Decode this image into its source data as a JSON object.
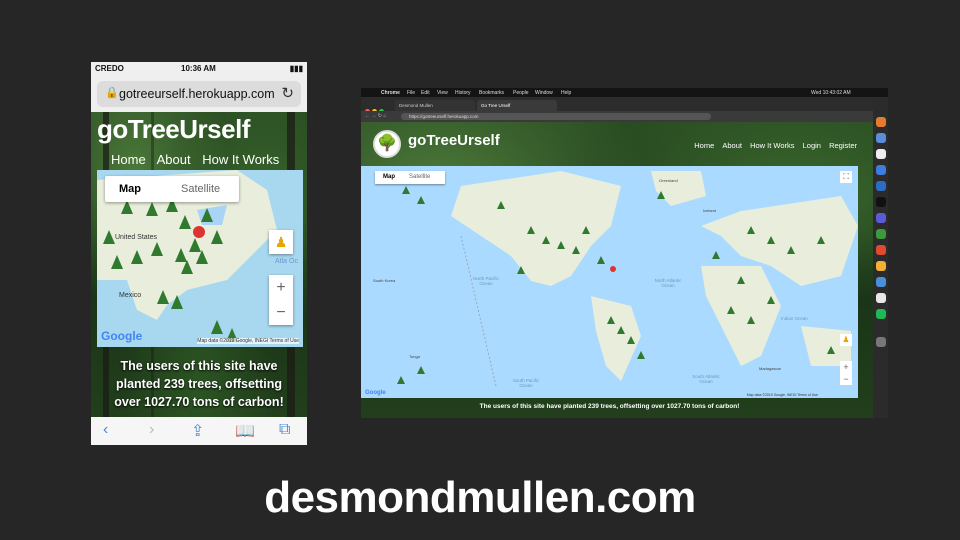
{
  "phone": {
    "status": {
      "carrier": "CREDO",
      "time": "10:36 AM"
    },
    "url": "gotreeurself.herokuapp.com",
    "app_title": "goTreeUrself",
    "nav": [
      "Home",
      "About",
      "How It Works"
    ],
    "map": {
      "tab_map": "Map",
      "tab_satellite": "Satellite",
      "labels": {
        "us": "United States",
        "mexico": "Mexico",
        "ocean": "Atla Oc"
      },
      "zoom_in": "+",
      "zoom_out": "−",
      "google": "Google",
      "attribution": "Map data ©2019 Google, INEGI   Terms of Use"
    },
    "footer": "The users of this site have planted 239 trees, offsetting over 1027.70 tons of carbon!"
  },
  "laptop": {
    "menubar": [
      "Chrome",
      "File",
      "Edit",
      "View",
      "History",
      "Bookmarks",
      "People",
      "Window",
      "Help"
    ],
    "clock": "Wed 10:43:02 AM",
    "tabs": [
      "Desmond Mullen",
      "Go Tree Urself"
    ],
    "url": "https://gotreeurself.herokuapp.com",
    "app_title": "goTreeUrself",
    "nav": [
      "Home",
      "About",
      "How It Works",
      "Login",
      "Register"
    ],
    "map": {
      "tab_map": "Map",
      "tab_satellite": "Satellite",
      "zoom_in": "+",
      "zoom_out": "−",
      "google": "Google",
      "attribution": "Map data ©2019 Google, INEGI   Terms of Use",
      "oceans": {
        "north_pacific": "North Pacific Ocean",
        "north_atlantic": "North Atlantic Ocean",
        "indian": "Indian Ocean",
        "south_pacific": "South Pacific Ocean",
        "south_atlantic": "South Atlantic Ocean"
      },
      "places": {
        "greenland": "Greenland",
        "iceland": "Iceland",
        "south_korea": "South Korea",
        "madagascar": "Madagascar",
        "tonga": "Tonga"
      }
    },
    "footer": "The users of this site have planted 239 trees, offsetting over 1027.70 tons of carbon!"
  },
  "caption": "desmondmullen.com",
  "colors": {
    "background": "#262626",
    "map_water": "#aadaff",
    "land": "#e8eedb",
    "tree": "#2f7a2e",
    "forest": "#1f3b1a"
  }
}
